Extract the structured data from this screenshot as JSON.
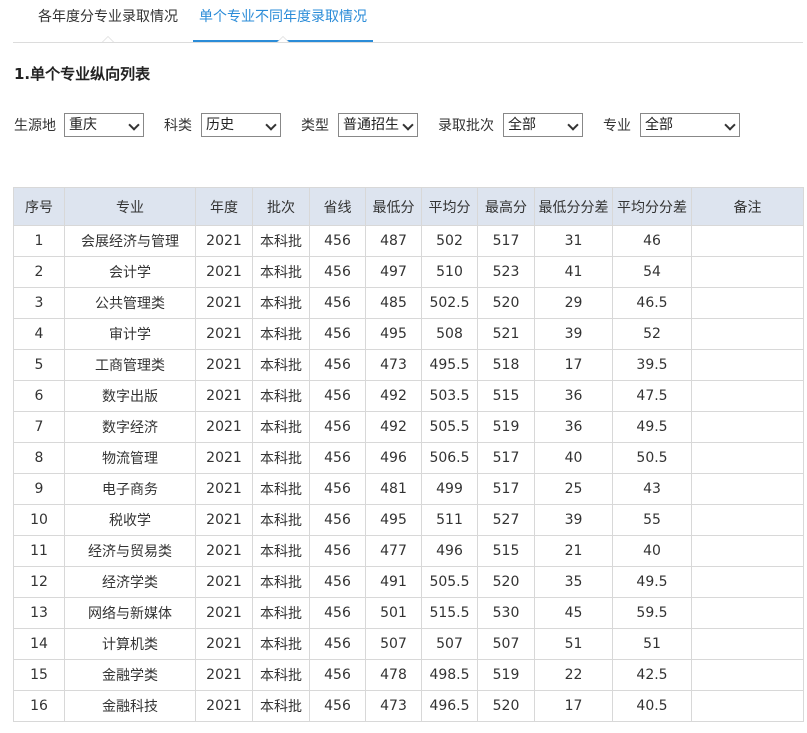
{
  "tabs": [
    {
      "label": "各年度分专业录取情况",
      "active": false
    },
    {
      "label": "单个专业不同年度录取情况",
      "active": true
    }
  ],
  "accent_color": "#2b8cd8",
  "section_title": "1.单个专业纵向列表",
  "filters": {
    "source": {
      "label": "生源地",
      "value": "重庆"
    },
    "subject": {
      "label": "科类",
      "value": "历史"
    },
    "type": {
      "label": "类型",
      "value": "普通招生"
    },
    "batch": {
      "label": "录取批次",
      "value": "全部"
    },
    "major": {
      "label": "专业",
      "value": "全部"
    }
  },
  "table": {
    "headers": [
      "序号",
      "专业",
      "年度",
      "批次",
      "省线",
      "最低分",
      "平均分",
      "最高分",
      "最低分分差",
      "平均分分差",
      "备注"
    ],
    "rows": [
      [
        "1",
        "会展经济与管理",
        "2021",
        "本科批",
        "456",
        "487",
        "502",
        "517",
        "31",
        "46",
        ""
      ],
      [
        "2",
        "会计学",
        "2021",
        "本科批",
        "456",
        "497",
        "510",
        "523",
        "41",
        "54",
        ""
      ],
      [
        "3",
        "公共管理类",
        "2021",
        "本科批",
        "456",
        "485",
        "502.5",
        "520",
        "29",
        "46.5",
        ""
      ],
      [
        "4",
        "审计学",
        "2021",
        "本科批",
        "456",
        "495",
        "508",
        "521",
        "39",
        "52",
        ""
      ],
      [
        "5",
        "工商管理类",
        "2021",
        "本科批",
        "456",
        "473",
        "495.5",
        "518",
        "17",
        "39.5",
        ""
      ],
      [
        "6",
        "数字出版",
        "2021",
        "本科批",
        "456",
        "492",
        "503.5",
        "515",
        "36",
        "47.5",
        ""
      ],
      [
        "7",
        "数字经济",
        "2021",
        "本科批",
        "456",
        "492",
        "505.5",
        "519",
        "36",
        "49.5",
        ""
      ],
      [
        "8",
        "物流管理",
        "2021",
        "本科批",
        "456",
        "496",
        "506.5",
        "517",
        "40",
        "50.5",
        ""
      ],
      [
        "9",
        "电子商务",
        "2021",
        "本科批",
        "456",
        "481",
        "499",
        "517",
        "25",
        "43",
        ""
      ],
      [
        "10",
        "税收学",
        "2021",
        "本科批",
        "456",
        "495",
        "511",
        "527",
        "39",
        "55",
        ""
      ],
      [
        "11",
        "经济与贸易类",
        "2021",
        "本科批",
        "456",
        "477",
        "496",
        "515",
        "21",
        "40",
        ""
      ],
      [
        "12",
        "经济学类",
        "2021",
        "本科批",
        "456",
        "491",
        "505.5",
        "520",
        "35",
        "49.5",
        ""
      ],
      [
        "13",
        "网络与新媒体",
        "2021",
        "本科批",
        "456",
        "501",
        "515.5",
        "530",
        "45",
        "59.5",
        ""
      ],
      [
        "14",
        "计算机类",
        "2021",
        "本科批",
        "456",
        "507",
        "507",
        "507",
        "51",
        "51",
        ""
      ],
      [
        "15",
        "金融学类",
        "2021",
        "本科批",
        "456",
        "478",
        "498.5",
        "519",
        "22",
        "42.5",
        ""
      ],
      [
        "16",
        "金融科技",
        "2021",
        "本科批",
        "456",
        "473",
        "496.5",
        "520",
        "17",
        "40.5",
        ""
      ]
    ]
  }
}
